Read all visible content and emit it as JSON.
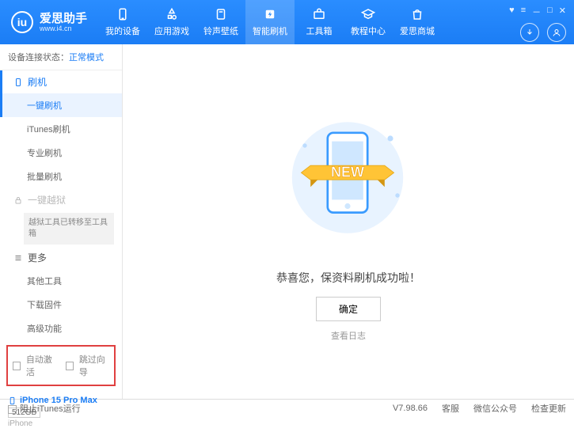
{
  "header": {
    "app_name": "爱思助手",
    "app_url": "www.i4.cn",
    "nav": [
      {
        "label": "我的设备"
      },
      {
        "label": "应用游戏"
      },
      {
        "label": "铃声壁纸"
      },
      {
        "label": "智能刷机"
      },
      {
        "label": "工具箱"
      },
      {
        "label": "教程中心"
      },
      {
        "label": "爱思商城"
      }
    ]
  },
  "sidebar": {
    "conn_prefix": "设备连接状态：",
    "conn_mode": "正常模式",
    "section_flash": "刷机",
    "items_flash": [
      "一键刷机",
      "iTunes刷机",
      "专业刷机",
      "批量刷机"
    ],
    "section_jailbreak": "一键越狱",
    "jailbreak_note": "越狱工具已转移至工具箱",
    "section_more": "更多",
    "items_more": [
      "其他工具",
      "下载固件",
      "高级功能"
    ],
    "cb_auto_activate": "自动激活",
    "cb_skip_guide": "跳过向导",
    "device": {
      "name": "iPhone 15 Pro Max",
      "capacity": "512GB",
      "type": "iPhone"
    }
  },
  "main": {
    "message": "恭喜您，保资料刷机成功啦！",
    "ok": "确定",
    "view_log": "查看日志",
    "badge": "NEW"
  },
  "status": {
    "block_itunes": "阻止iTunes运行",
    "version": "V7.98.66",
    "support": "客服",
    "wechat": "微信公众号",
    "check_update": "检查更新"
  }
}
